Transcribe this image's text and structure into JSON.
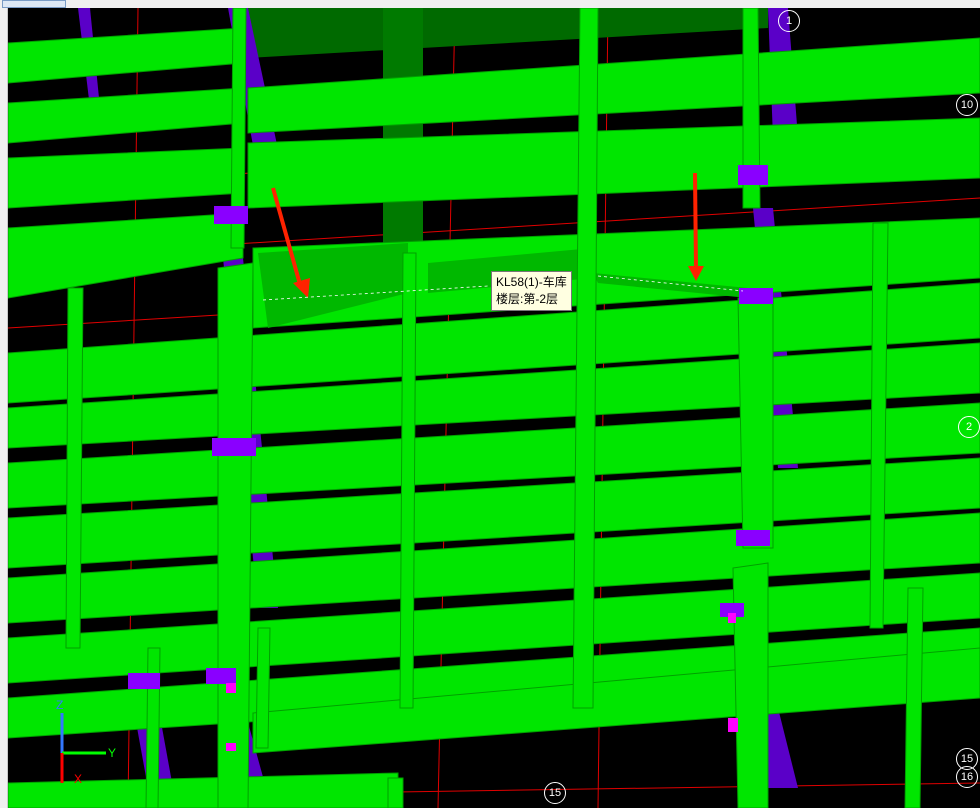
{
  "tooltip": {
    "component_name": "KL58(1)-车库",
    "floor_info": "楼层:第-2层"
  },
  "grid_labels": {
    "top_right": "1",
    "right_10": "10",
    "right_12": "2",
    "right_15": "15",
    "right_16": "16",
    "bottom_15": "15"
  },
  "axis": {
    "z": "Z",
    "y": "Y",
    "x": "X"
  },
  "colors": {
    "beam": "#00e600",
    "beam_dark": "#008800",
    "column": "#5a00c8",
    "column_cap": "#8a00ff",
    "grid_line": "#e00000",
    "arrow": "#ff2200",
    "background": "#000000"
  }
}
